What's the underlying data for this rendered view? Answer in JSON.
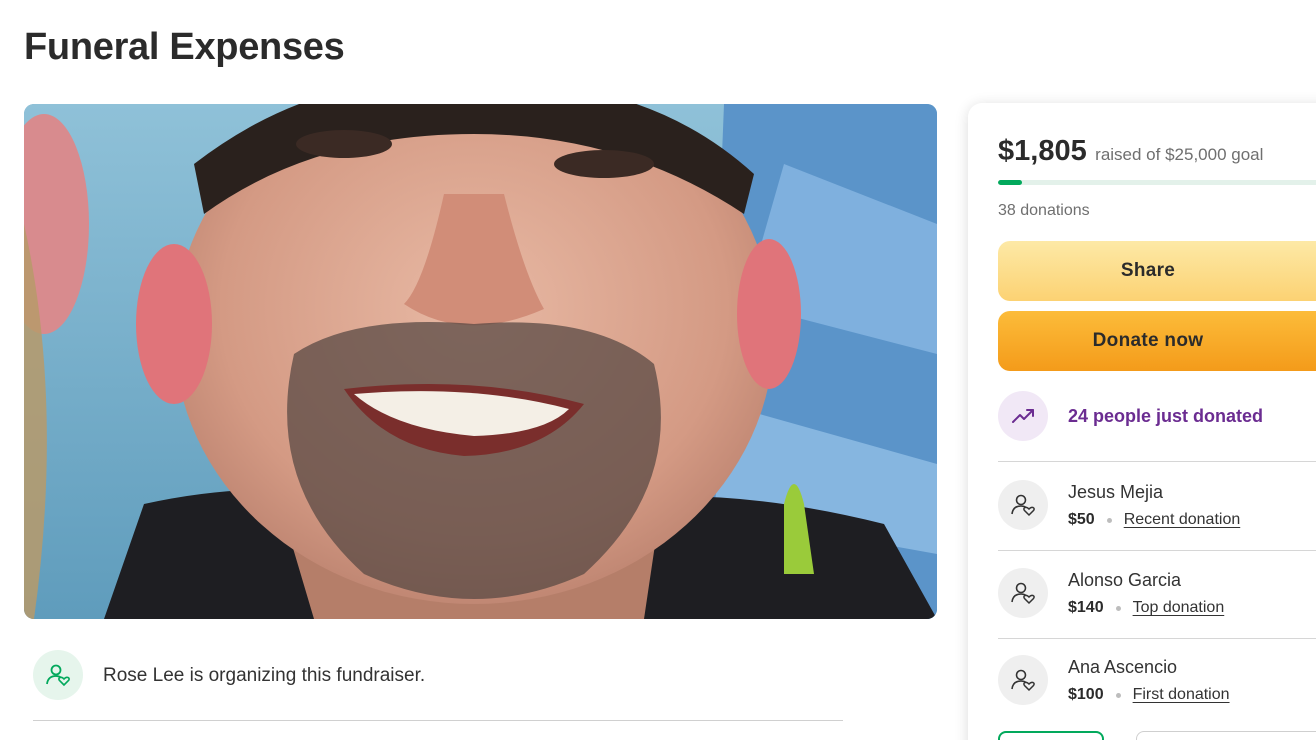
{
  "page": {
    "title": "Funeral Expenses"
  },
  "organizer": {
    "text": "Rose Lee is organizing this fundraiser."
  },
  "campaign": {
    "raised": "$1,805",
    "goal_text": "raised of $25,000 goal",
    "progress_fraction": 0.0722,
    "donation_count": "38 donations",
    "share_label": "Share",
    "donate_label": "Donate now",
    "trending_text": "24 people just donated"
  },
  "donors": [
    {
      "name": "Jesus Mejia",
      "amount": "$50",
      "tag": "Recent donation"
    },
    {
      "name": "Alonso Garcia",
      "amount": "$140",
      "tag": "Top donation"
    },
    {
      "name": "Ana Ascencio",
      "amount": "$100",
      "tag": "First donation"
    }
  ],
  "colors": {
    "accent_green": "#02a95c",
    "trend_purple": "#6b2c91",
    "donate_orange": "#f49b1a",
    "share_yellow": "#fcd273"
  },
  "icons": {
    "organizer": "person-heart-icon",
    "trending": "trending-up-icon",
    "donor": "person-heart-icon"
  }
}
